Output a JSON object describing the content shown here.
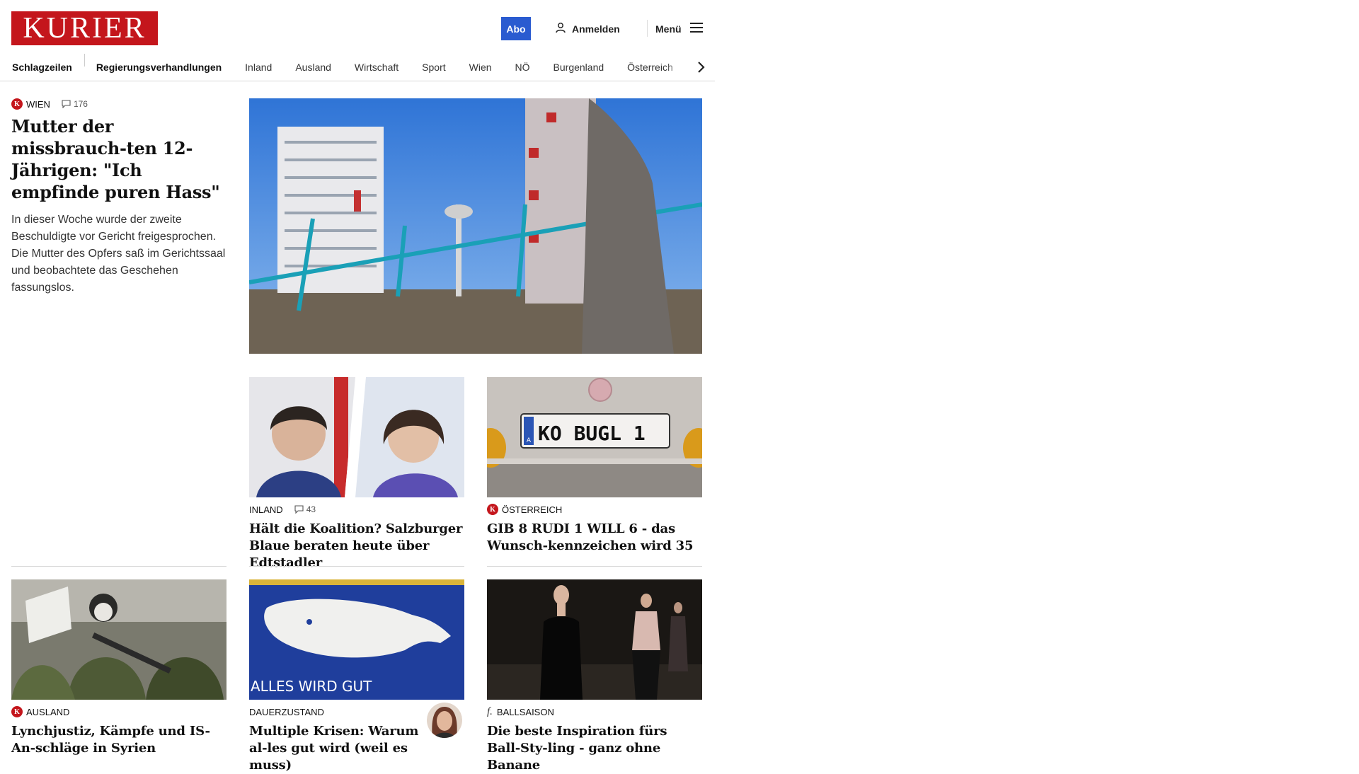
{
  "brand": {
    "logo_text": "KURIER",
    "brand_color": "#c4161c",
    "accent_color": "#2a5bd0"
  },
  "header": {
    "abo_label": "Abo",
    "login_label": "Anmelden",
    "menu_label": "Menü",
    "icons": {
      "login": "user-icon",
      "menu": "hamburger-icon"
    }
  },
  "nav": {
    "items": [
      {
        "label": "Schlagzeilen"
      },
      {
        "label": "Regierungsverhandlungen"
      },
      {
        "label": "Inland"
      },
      {
        "label": "Ausland"
      },
      {
        "label": "Wirtschaft"
      },
      {
        "label": "Sport"
      },
      {
        "label": "Wien"
      },
      {
        "label": "NÖ"
      },
      {
        "label": "Burgenland"
      },
      {
        "label": "Österreich"
      }
    ],
    "scroll_icon": "chevron-right-icon"
  },
  "lead": {
    "category": "WIEN",
    "comments": "176",
    "headline": "Mutter der missbrauch-ten 12-Jährigen: \"Ich empfinde puren Hass\"",
    "teaser": "In dieser Woche wurde der zweite Beschuldigte vor Gericht freigesprochen. Die Mutter des Opfers saß im Gerichtssaal und beobachtete das Geschehen fassungslos."
  },
  "cards": [
    {
      "category": "INLAND",
      "comments": "43",
      "headline": "Hält die Koalition? Salzburger Blaue beraten heute über Edtstadler"
    },
    {
      "category": "ÖSTERREICH",
      "headline": "GIB 8 RUDI 1 WILL 6 - das Wunsch-kennzeichen wird 35",
      "plate_text": "KO BUGL 1",
      "plate_country": "A"
    },
    {
      "category": "AUSLAND",
      "headline": "Lynchjustiz, Kämpfe und IS-An-schläge in Syrien"
    },
    {
      "category": "DAUERZUSTAND",
      "headline": "Multiple Krisen: Warum al-les gut wird (weil es muss)",
      "image_text": "ALLES WIRD GUT"
    },
    {
      "category": "BALLSAISON",
      "headline": "Die beste Inspiration fürs Ball-Sty-ling - ganz ohne Banane"
    }
  ]
}
